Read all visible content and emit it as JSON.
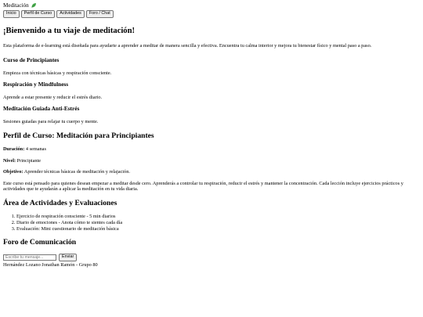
{
  "header": {
    "title": "Meditación",
    "icon": "leaf-icon",
    "nav": [
      "Inicio",
      "Perfil de Curso",
      "Actividades",
      "Foro / Chat"
    ]
  },
  "welcome": {
    "title": "¡Bienvenido a tu viaje de meditación!",
    "intro": "Esta plataforma de e-learning está diseñada para ayudarte a aprender a meditar de manera sencilla y efectiva. Encuentra tu calma interior y mejora tu bienestar físico y mental paso a paso.",
    "courses": [
      {
        "title": "Curso de Principiantes",
        "desc": "Empieza con técnicas básicas y respiración consciente."
      },
      {
        "title": "Respiración y Mindfulness",
        "desc": "Aprende a estar presente y reducir el estrés diario."
      },
      {
        "title": "Meditación Guiada Anti-Estrés",
        "desc": "Sesiones guiadas para relajar tu cuerpo y mente."
      }
    ]
  },
  "profile": {
    "title": "Perfil de Curso: Meditación para Principiantes",
    "duration_label": "Duración:",
    "duration": "4 semanas",
    "level_label": "Nivel:",
    "level": "Principiante",
    "objective_label": "Objetivo:",
    "objective": "Aprender técnicas básicas de meditación y relajación.",
    "description": "Este curso está pensado para quienes desean empezar a meditar desde cero. Aprenderás a controlar tu respiración, reducir el estrés y mantener la concentración. Cada lección incluye ejercicios prácticos y actividades que te ayudarán a aplicar la meditación en tu vida diaria."
  },
  "activities": {
    "title": "Área de Actividades y Evaluaciones",
    "items": [
      "Ejercicio de respiración consciente - 5 min diarios",
      "Diario de emociones - Anota cómo te sientes cada día",
      "Evaluación: Mini cuestionario de meditación básica"
    ]
  },
  "forum": {
    "title": "Foro de Comunicación",
    "placeholder": "Escribe tu mensaje...",
    "send_label": "Enviar"
  },
  "footer": "Hernández Lozano Jonathan Ramón - Grupo 80"
}
